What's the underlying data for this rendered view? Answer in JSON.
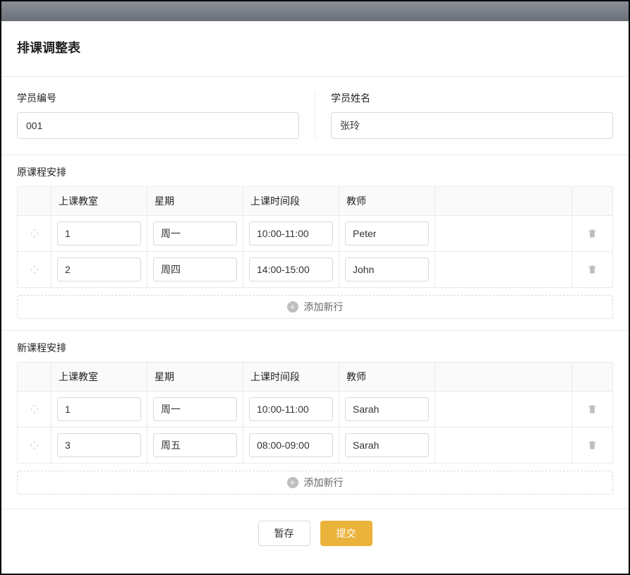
{
  "page": {
    "title": "排课调整表"
  },
  "student": {
    "id_label": "学员编号",
    "id_value": "001",
    "name_label": "学员姓名",
    "name_value": "张玲"
  },
  "columns": {
    "room": "上课教室",
    "day": "星期",
    "time": "上课时间段",
    "teacher": "教师"
  },
  "original": {
    "title": "原课程安排",
    "rows": [
      {
        "room": "1",
        "day": "周一",
        "time": "10:00-11:00",
        "teacher": "Peter"
      },
      {
        "room": "2",
        "day": "周四",
        "time": "14:00-15:00",
        "teacher": "John"
      }
    ]
  },
  "updated": {
    "title": "新课程安排",
    "rows": [
      {
        "room": "1",
        "day": "周一",
        "time": "10:00-11:00",
        "teacher": "Sarah"
      },
      {
        "room": "3",
        "day": "周五",
        "time": "08:00-09:00",
        "teacher": "Sarah"
      }
    ]
  },
  "actions": {
    "add_row": "添加新行",
    "save_draft": "暂存",
    "submit": "提交"
  }
}
